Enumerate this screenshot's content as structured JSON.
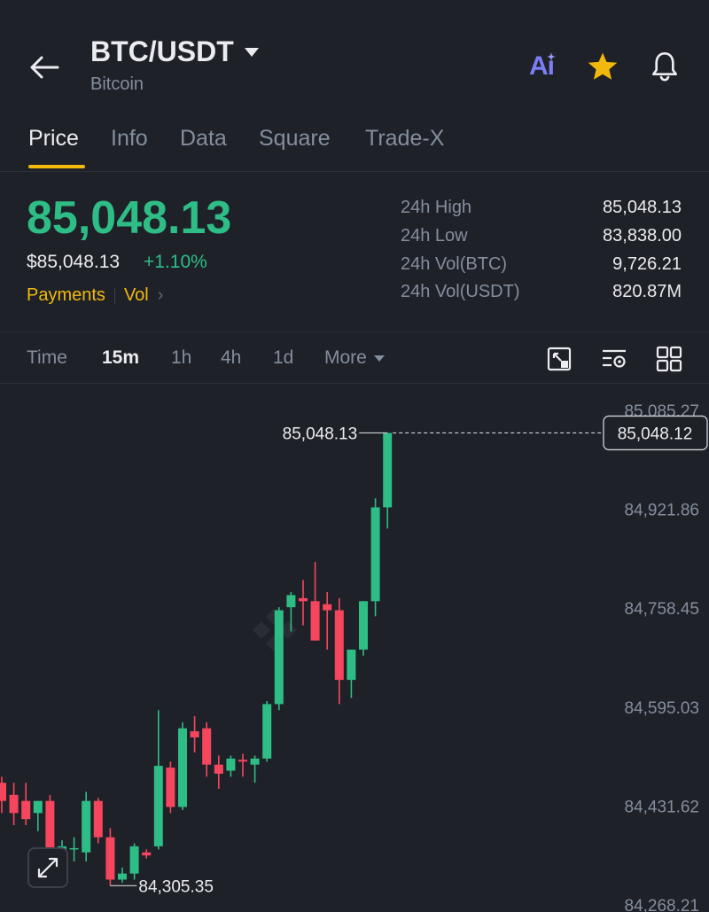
{
  "header": {
    "pair": "BTC/USDT",
    "name": "Bitcoin",
    "ai_label": "Ai"
  },
  "tabs": [
    "Price",
    "Info",
    "Data",
    "Square",
    "Trade-X"
  ],
  "ticker": {
    "last_price": "85,048.13",
    "usd_price": "$85,048.13",
    "change": "+1.10%",
    "link_payments": "Payments",
    "link_vol": "Vol",
    "stats": [
      {
        "label": "24h High",
        "value": "85,048.13"
      },
      {
        "label": "24h Low",
        "value": "83,838.00"
      },
      {
        "label": "24h Vol(BTC)",
        "value": "9,726.21"
      },
      {
        "label": "24h Vol(USDT)",
        "value": "820.87M"
      }
    ]
  },
  "intervals": [
    "Time",
    "15m",
    "1h",
    "4h",
    "1d",
    "More"
  ],
  "colors": {
    "up": "#2ebd85",
    "down": "#f6465d",
    "accent": "#f0b90b",
    "background": "#1f2129"
  },
  "chart_data": {
    "type": "candlestick",
    "y_ticks": [
      "85,085.27",
      "84,921.86",
      "84,758.45",
      "84,595.03",
      "84,431.62",
      "84,268.21"
    ],
    "y_tick_values": [
      85085.27,
      84921.86,
      84758.45,
      84595.03,
      84431.62,
      84268.21
    ],
    "ylim": [
      84268.21,
      85085.27
    ],
    "current_price_label": "85,048.12",
    "high_marker_label": "85,048.13",
    "low_marker_label": "84,305.35",
    "candles": [
      {
        "o": 84470,
        "h": 84480,
        "l": 84420,
        "c": 84440
      },
      {
        "o": 84450,
        "h": 84470,
        "l": 84400,
        "c": 84420
      },
      {
        "o": 84440,
        "h": 84470,
        "l": 84400,
        "c": 84410
      },
      {
        "o": 84420,
        "h": 84440,
        "l": 84390,
        "c": 84440
      },
      {
        "o": 84440,
        "h": 84450,
        "l": 84320,
        "c": 84355
      },
      {
        "o": 84350,
        "h": 84375,
        "l": 84335,
        "c": 84365
      },
      {
        "o": 84360,
        "h": 84380,
        "l": 84340,
        "c": 84362
      },
      {
        "o": 84355,
        "h": 84455,
        "l": 84340,
        "c": 84440
      },
      {
        "o": 84440,
        "h": 84445,
        "l": 84370,
        "c": 84380
      },
      {
        "o": 84380,
        "h": 84395,
        "l": 84300,
        "c": 84310
      },
      {
        "o": 84310,
        "h": 84330,
        "l": 84305,
        "c": 84320
      },
      {
        "o": 84320,
        "h": 84370,
        "l": 84310,
        "c": 84365
      },
      {
        "o": 84355,
        "h": 84360,
        "l": 84345,
        "c": 84350
      },
      {
        "o": 84365,
        "h": 84590,
        "l": 84360,
        "c": 84498
      },
      {
        "o": 84495,
        "h": 84505,
        "l": 84420,
        "c": 84430
      },
      {
        "o": 84430,
        "h": 84570,
        "l": 84425,
        "c": 84560
      },
      {
        "o": 84555,
        "h": 84580,
        "l": 84520,
        "c": 84545
      },
      {
        "o": 84560,
        "h": 84570,
        "l": 84480,
        "c": 84500
      },
      {
        "o": 84500,
        "h": 84515,
        "l": 84460,
        "c": 84485
      },
      {
        "o": 84490,
        "h": 84515,
        "l": 84480,
        "c": 84510
      },
      {
        "o": 84508,
        "h": 84518,
        "l": 84480,
        "c": 84505
      },
      {
        "o": 84500,
        "h": 84515,
        "l": 84470,
        "c": 84510
      },
      {
        "o": 84510,
        "h": 84605,
        "l": 84505,
        "c": 84600
      },
      {
        "o": 84600,
        "h": 84760,
        "l": 84590,
        "c": 84755
      },
      {
        "o": 84760,
        "h": 84785,
        "l": 84720,
        "c": 84780
      },
      {
        "o": 84775,
        "h": 84805,
        "l": 84730,
        "c": 84770
      },
      {
        "o": 84770,
        "h": 84835,
        "l": 84705,
        "c": 84705
      },
      {
        "o": 84765,
        "h": 84785,
        "l": 84690,
        "c": 84755
      },
      {
        "o": 84755,
        "h": 84775,
        "l": 84600,
        "c": 84640
      },
      {
        "o": 84640,
        "h": 84690,
        "l": 84610,
        "c": 84690
      },
      {
        "o": 84690,
        "h": 84770,
        "l": 84680,
        "c": 84770
      },
      {
        "o": 84770,
        "h": 84940,
        "l": 84745,
        "c": 84925
      },
      {
        "o": 84925,
        "h": 85048,
        "l": 84890,
        "c": 85048
      }
    ]
  }
}
